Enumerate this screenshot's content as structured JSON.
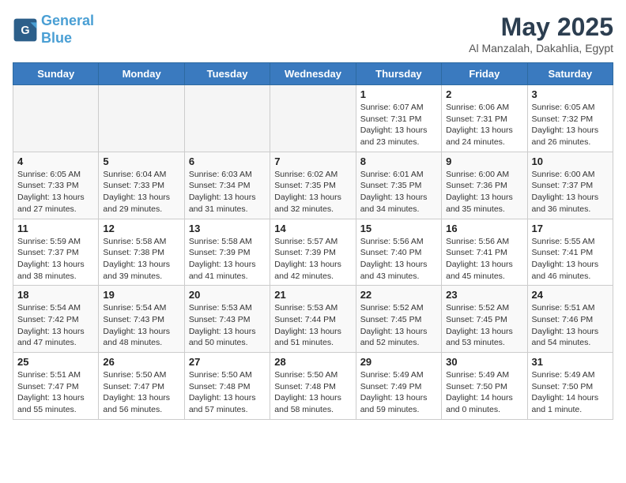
{
  "header": {
    "logo_line1": "General",
    "logo_line2": "Blue",
    "month": "May 2025",
    "location": "Al Manzalah, Dakahlia, Egypt"
  },
  "weekdays": [
    "Sunday",
    "Monday",
    "Tuesday",
    "Wednesday",
    "Thursday",
    "Friday",
    "Saturday"
  ],
  "weeks": [
    [
      {
        "day": "",
        "info": ""
      },
      {
        "day": "",
        "info": ""
      },
      {
        "day": "",
        "info": ""
      },
      {
        "day": "",
        "info": ""
      },
      {
        "day": "1",
        "info": "Sunrise: 6:07 AM\nSunset: 7:31 PM\nDaylight: 13 hours\nand 23 minutes."
      },
      {
        "day": "2",
        "info": "Sunrise: 6:06 AM\nSunset: 7:31 PM\nDaylight: 13 hours\nand 24 minutes."
      },
      {
        "day": "3",
        "info": "Sunrise: 6:05 AM\nSunset: 7:32 PM\nDaylight: 13 hours\nand 26 minutes."
      }
    ],
    [
      {
        "day": "4",
        "info": "Sunrise: 6:05 AM\nSunset: 7:33 PM\nDaylight: 13 hours\nand 27 minutes."
      },
      {
        "day": "5",
        "info": "Sunrise: 6:04 AM\nSunset: 7:33 PM\nDaylight: 13 hours\nand 29 minutes."
      },
      {
        "day": "6",
        "info": "Sunrise: 6:03 AM\nSunset: 7:34 PM\nDaylight: 13 hours\nand 31 minutes."
      },
      {
        "day": "7",
        "info": "Sunrise: 6:02 AM\nSunset: 7:35 PM\nDaylight: 13 hours\nand 32 minutes."
      },
      {
        "day": "8",
        "info": "Sunrise: 6:01 AM\nSunset: 7:35 PM\nDaylight: 13 hours\nand 34 minutes."
      },
      {
        "day": "9",
        "info": "Sunrise: 6:00 AM\nSunset: 7:36 PM\nDaylight: 13 hours\nand 35 minutes."
      },
      {
        "day": "10",
        "info": "Sunrise: 6:00 AM\nSunset: 7:37 PM\nDaylight: 13 hours\nand 36 minutes."
      }
    ],
    [
      {
        "day": "11",
        "info": "Sunrise: 5:59 AM\nSunset: 7:37 PM\nDaylight: 13 hours\nand 38 minutes."
      },
      {
        "day": "12",
        "info": "Sunrise: 5:58 AM\nSunset: 7:38 PM\nDaylight: 13 hours\nand 39 minutes."
      },
      {
        "day": "13",
        "info": "Sunrise: 5:58 AM\nSunset: 7:39 PM\nDaylight: 13 hours\nand 41 minutes."
      },
      {
        "day": "14",
        "info": "Sunrise: 5:57 AM\nSunset: 7:39 PM\nDaylight: 13 hours\nand 42 minutes."
      },
      {
        "day": "15",
        "info": "Sunrise: 5:56 AM\nSunset: 7:40 PM\nDaylight: 13 hours\nand 43 minutes."
      },
      {
        "day": "16",
        "info": "Sunrise: 5:56 AM\nSunset: 7:41 PM\nDaylight: 13 hours\nand 45 minutes."
      },
      {
        "day": "17",
        "info": "Sunrise: 5:55 AM\nSunset: 7:41 PM\nDaylight: 13 hours\nand 46 minutes."
      }
    ],
    [
      {
        "day": "18",
        "info": "Sunrise: 5:54 AM\nSunset: 7:42 PM\nDaylight: 13 hours\nand 47 minutes."
      },
      {
        "day": "19",
        "info": "Sunrise: 5:54 AM\nSunset: 7:43 PM\nDaylight: 13 hours\nand 48 minutes."
      },
      {
        "day": "20",
        "info": "Sunrise: 5:53 AM\nSunset: 7:43 PM\nDaylight: 13 hours\nand 50 minutes."
      },
      {
        "day": "21",
        "info": "Sunrise: 5:53 AM\nSunset: 7:44 PM\nDaylight: 13 hours\nand 51 minutes."
      },
      {
        "day": "22",
        "info": "Sunrise: 5:52 AM\nSunset: 7:45 PM\nDaylight: 13 hours\nand 52 minutes."
      },
      {
        "day": "23",
        "info": "Sunrise: 5:52 AM\nSunset: 7:45 PM\nDaylight: 13 hours\nand 53 minutes."
      },
      {
        "day": "24",
        "info": "Sunrise: 5:51 AM\nSunset: 7:46 PM\nDaylight: 13 hours\nand 54 minutes."
      }
    ],
    [
      {
        "day": "25",
        "info": "Sunrise: 5:51 AM\nSunset: 7:47 PM\nDaylight: 13 hours\nand 55 minutes."
      },
      {
        "day": "26",
        "info": "Sunrise: 5:50 AM\nSunset: 7:47 PM\nDaylight: 13 hours\nand 56 minutes."
      },
      {
        "day": "27",
        "info": "Sunrise: 5:50 AM\nSunset: 7:48 PM\nDaylight: 13 hours\nand 57 minutes."
      },
      {
        "day": "28",
        "info": "Sunrise: 5:50 AM\nSunset: 7:48 PM\nDaylight: 13 hours\nand 58 minutes."
      },
      {
        "day": "29",
        "info": "Sunrise: 5:49 AM\nSunset: 7:49 PM\nDaylight: 13 hours\nand 59 minutes."
      },
      {
        "day": "30",
        "info": "Sunrise: 5:49 AM\nSunset: 7:50 PM\nDaylight: 14 hours\nand 0 minutes."
      },
      {
        "day": "31",
        "info": "Sunrise: 5:49 AM\nSunset: 7:50 PM\nDaylight: 14 hours\nand 1 minute."
      }
    ]
  ]
}
